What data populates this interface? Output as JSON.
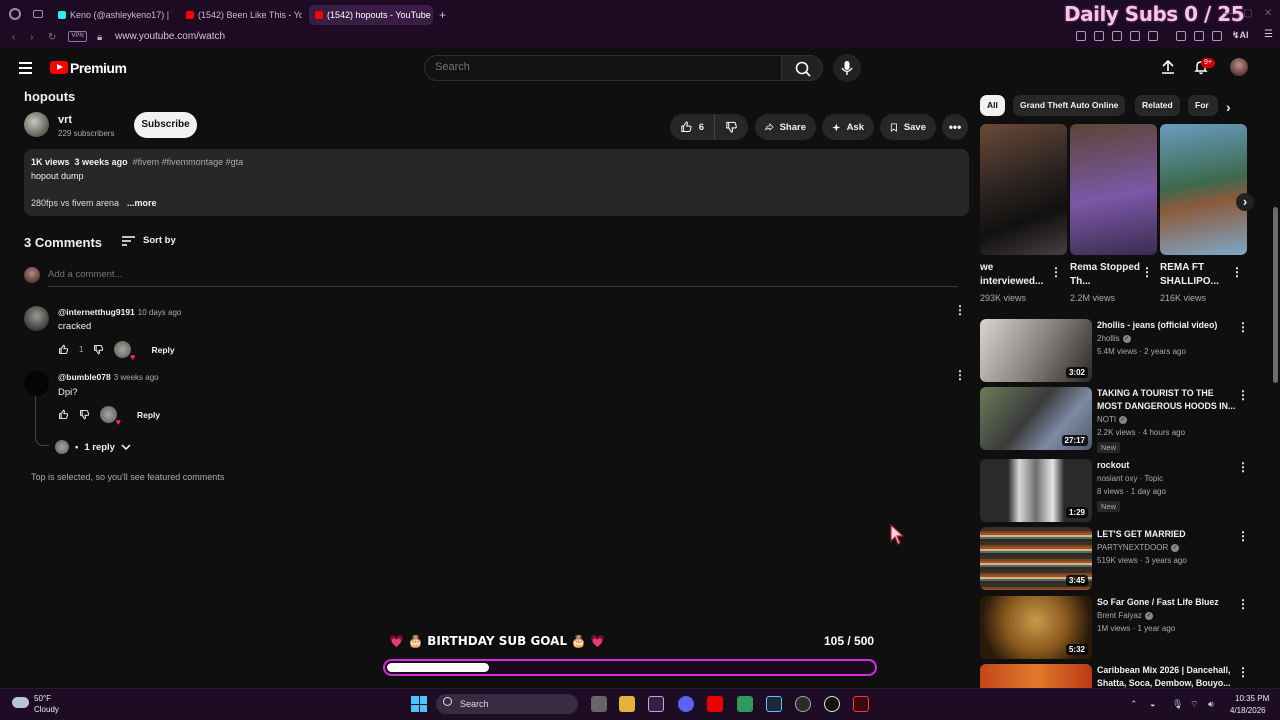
{
  "browser": {
    "tabs": [
      {
        "label": "Keno (@ashleykeno17) | T"
      },
      {
        "label": "(1542) Been Like This - Yo"
      },
      {
        "label": "(1542) hopouts - YouTube"
      }
    ],
    "new_tab": "+",
    "vpn_label": "VPN",
    "url": "www.youtube.com/watch",
    "overlay_sub_goal": "Daily Subs  0 / 25"
  },
  "header": {
    "brand": "Premium",
    "search_placeholder": "Search",
    "notifications_badge": "9+"
  },
  "video": {
    "title": "hopouts",
    "channel_name": "vrt",
    "channel_subs": "229 subscribers",
    "subscribe_label": "Subscribe",
    "like_count": "6",
    "share_label": "Share",
    "ask_label": "Ask",
    "save_label": "Save",
    "desc_views": "1K views",
    "desc_age": "3 weeks ago",
    "desc_tags": "#fivem #fivemmontage #gta",
    "desc_line1": "hopout dump",
    "desc_line2": "280fps vs fivem arena",
    "desc_more": "...more"
  },
  "comments": {
    "count_label": "3 Comments",
    "sort_label": "Sort by",
    "add_placeholder": "Add a comment...",
    "items": [
      {
        "author": "@internetthug9191",
        "time": "10 days ago",
        "text": "cracked",
        "likes": "1",
        "reply": "Reply"
      },
      {
        "author": "@bumble078",
        "time": "3 weeks ago",
        "text": "Dpi?",
        "likes": "",
        "reply": "Reply"
      }
    ],
    "replies_label": "1 reply",
    "top_note": "Top is selected, so you'll see featured comments"
  },
  "goal": {
    "title": "💗 🎂 BIRTHDAY SUB GOAL 🎂 💗",
    "count": "105 / 500",
    "progress": 0.21
  },
  "sidebar": {
    "chips": [
      "All",
      "Grand Theft Auto Online",
      "Related",
      "For"
    ],
    "shorts": [
      {
        "title": "we interviewed...",
        "views": "293K views"
      },
      {
        "title": "Rema Stopped Th...",
        "views": "2.2M views"
      },
      {
        "title": "REMA FT SHALLIPO...",
        "views": "216K views"
      }
    ],
    "videos": [
      {
        "title": "2hollis - jeans (official video)",
        "channel": "2hollis",
        "meta": "5.4M views · 2 years ago",
        "duration": "3:02",
        "badge": ""
      },
      {
        "title": "TAKING A TOURIST TO THE MOST DANGEROUS HOODS IN...",
        "channel": "NOTI",
        "meta": "2.2K views · 4 hours ago",
        "duration": "27:17",
        "badge": "New"
      },
      {
        "title": "rockout",
        "channel": "nosiant oxy · Topic",
        "meta": "8 views · 1 day ago",
        "duration": "1:29",
        "badge": "New"
      },
      {
        "title": "LET'S GET MARRIED",
        "channel": "PARTYNEXTDOOR",
        "meta": "519K views · 3 years ago",
        "duration": "3:45",
        "badge": ""
      },
      {
        "title": "So Far Gone / Fast Life Bluez",
        "channel": "Brent Faiyaz",
        "meta": "1M views · 1 year ago",
        "duration": "5:32",
        "badge": ""
      },
      {
        "title": "Caribbean Mix 2026 | Dancehall, Shatta, Soca, Dembow, Bouyo...",
        "channel": "",
        "meta": "",
        "duration": "",
        "badge": ""
      }
    ]
  },
  "taskbar": {
    "weather_temp": "50°F",
    "weather_cond": "Cloudy",
    "search_label": "Search",
    "time": "10:35 PM",
    "date": "4/18/2026"
  },
  "colors": {
    "accent_red": "#ff0000",
    "goal_border": "#d52be0",
    "chrome_bg": "#1c0b22"
  }
}
